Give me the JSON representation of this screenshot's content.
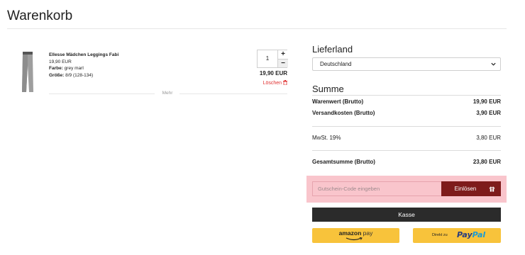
{
  "page": {
    "title": "Warenkorb"
  },
  "product": {
    "name": "Ellesse Mädchen Leggings Fabi",
    "unit_price": "19,90 EUR",
    "color_label": "Farbe:",
    "color_value": "grey marl",
    "size_label": "Größe:",
    "size_value": "8/9 (128-134)",
    "quantity": "1",
    "plus": "+",
    "minus": "−",
    "line_total": "19,90 EUR",
    "delete_label": "Löschen",
    "delete_icon": "trash-icon",
    "more_label": "Mehr"
  },
  "shipping": {
    "title": "Lieferland",
    "country_selected": "Deutschland"
  },
  "summary": {
    "title": "Summe",
    "goods_label": "Warenwert (Brutto)",
    "goods_value": "19,90 EUR",
    "shipping_label": "Versandkosten (Brutto)",
    "shipping_value": "3,90 EUR",
    "vat_label": "MwSt. 19%",
    "vat_value": "3,80 EUR",
    "total_label": "Gesamtsumme (Brutto)",
    "total_value": "23,80 EUR"
  },
  "voucher": {
    "placeholder": "Gutschein-Code eingeben",
    "button_label": "Einlösen",
    "button_icon": "gift-icon"
  },
  "checkout": {
    "label": "Kasse"
  },
  "amazon_pay": {
    "brand": "amazon",
    "suffix": "pay"
  },
  "paypal": {
    "prefix": "Direkt zu",
    "brand_a": "Pay",
    "brand_b": "Pal"
  },
  "colors": {
    "accent_dark_red": "#7e1b1b",
    "highlight_pink": "#f9c5cc",
    "button_dark": "#2b2b2b",
    "pay_yellow": "#f8c33b",
    "delete_red": "#e03030"
  }
}
